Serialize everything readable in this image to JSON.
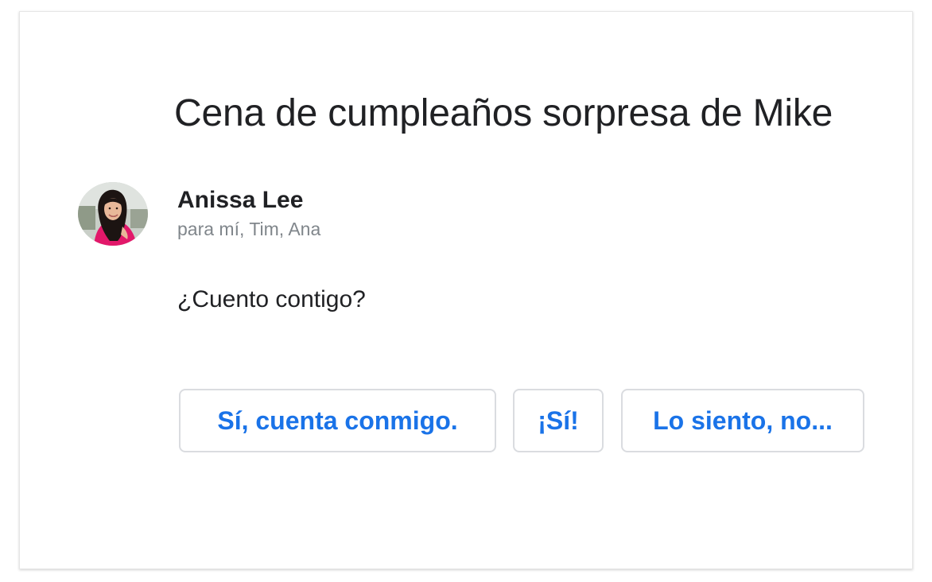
{
  "email": {
    "subject": "Cena de cumpleaños sorpresa de Mike",
    "sender": {
      "name": "Anissa Lee",
      "recipients": "para mí, Tim, Ana",
      "avatar": "avatar-photo"
    },
    "body": "¿Cuento contigo?"
  },
  "smart_replies": [
    {
      "label": "Sí, cuenta conmigo."
    },
    {
      "label": "¡Sí!"
    },
    {
      "label": "Lo siento, no..."
    }
  ],
  "colors": {
    "reply_text": "#1a73e8",
    "reply_border": "#dadce0",
    "primary_text": "#202124",
    "secondary_text": "#80868b"
  }
}
